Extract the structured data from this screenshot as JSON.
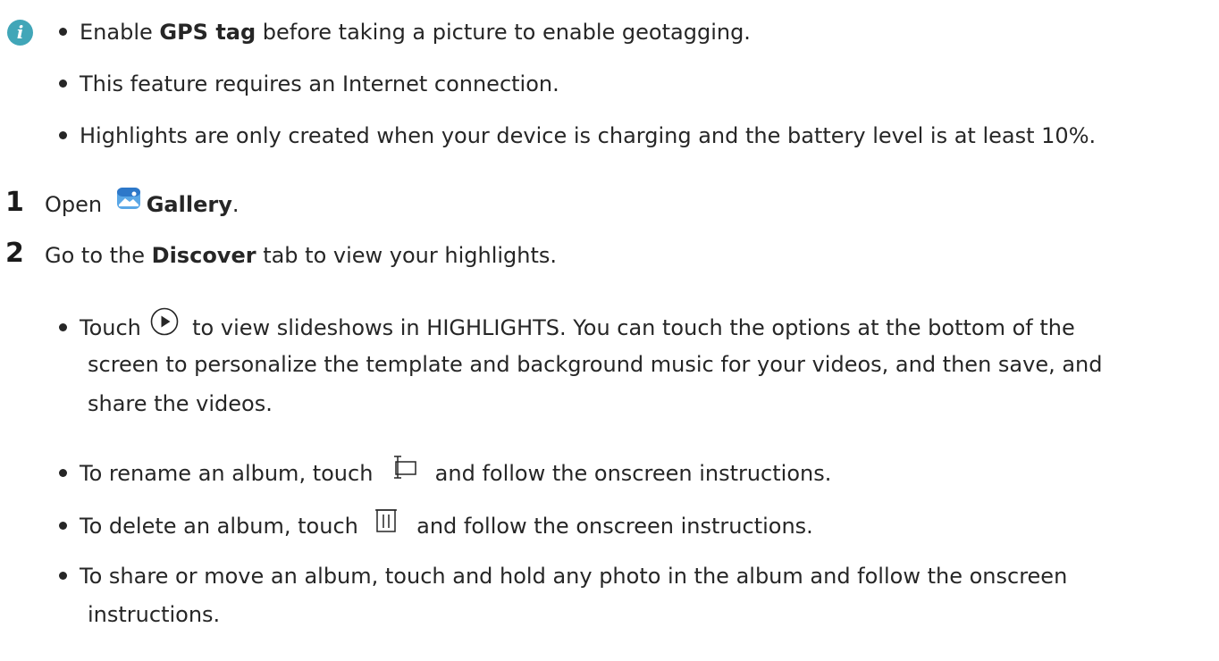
{
  "notes": {
    "icon": "info-icon",
    "items": [
      {
        "pre": "Enable ",
        "bold": "GPS tag",
        "post": " before taking a picture to enable geotagging."
      },
      {
        "text": "This feature requires an Internet connection."
      },
      {
        "text": "Highlights are only created when your device is charging and the battery level is at least 10%."
      }
    ]
  },
  "steps": [
    {
      "num": "1",
      "pre": "Open ",
      "icon": "gallery-icon",
      "bold": "Gallery",
      "post": "."
    },
    {
      "num": "2",
      "pre": "Go to the ",
      "bold": "Discover",
      "post": " tab to view your highlights."
    }
  ],
  "sub_items": [
    {
      "pre": "Touch ",
      "icon": "play-icon",
      "lines": [
        " to view slideshows in HIGHLIGHTS. You can touch the options at the bottom of the",
        "screen to personalize the template and background music for your videos, and then save, and",
        "share the videos."
      ]
    },
    {
      "pre": "To rename an album, touch ",
      "icon": "rename-icon",
      "post": " and follow the onscreen instructions."
    },
    {
      "pre": "To delete an album, touch ",
      "icon": "trash-icon",
      "post": " and follow the onscreen instructions."
    },
    {
      "lines": [
        "To share or move an album, touch and hold any photo in the album and follow the onscreen",
        "instructions."
      ]
    }
  ]
}
